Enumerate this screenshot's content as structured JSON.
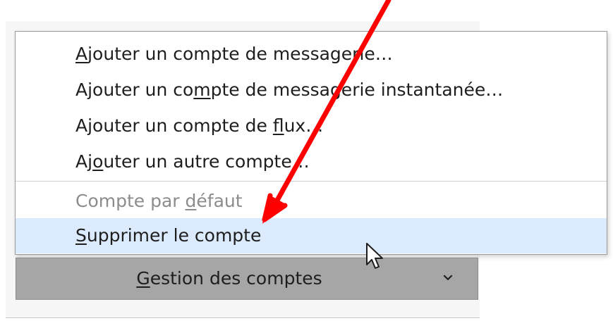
{
  "menu": {
    "items": [
      {
        "pre": "",
        "u": "A",
        "post": "jouter un compte de messagerie…",
        "state": "normal"
      },
      {
        "pre": "Ajouter un co",
        "u": "m",
        "post": "pte de messagerie instantanée…",
        "state": "normal"
      },
      {
        "pre": "Ajouter un compte de ",
        "u": "f",
        "post": "lux…",
        "state": "normal"
      },
      {
        "pre": "Aj",
        "u": "o",
        "post": "uter un autre compte…",
        "state": "normal"
      },
      {
        "pre": "Compte par ",
        "u": "d",
        "post": "éfaut",
        "state": "disabled"
      },
      {
        "pre": "",
        "u": "S",
        "post": "upprimer le compte",
        "state": "hover"
      }
    ]
  },
  "account_button": {
    "pre": "",
    "u": "G",
    "post": "estion des comptes"
  },
  "icons": {
    "dropdown": "chevron-down-icon",
    "pointer": "mouse-pointer-icon",
    "annotation": "red-arrow-annotation"
  },
  "colors": {
    "hover_bg": "#dbeafc",
    "button_bg": "#a6a6a6",
    "annotation_red": "#ff0000",
    "disabled_text": "#8c8c8c"
  }
}
